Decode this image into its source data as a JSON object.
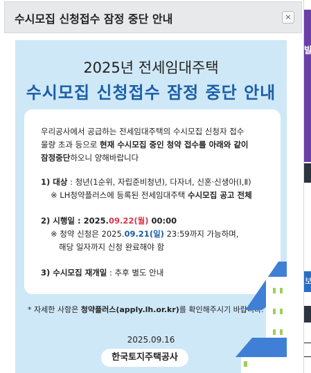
{
  "popup": {
    "title": "수시모집 신청접수 잠정 중단 안내",
    "close_label": "×"
  },
  "notice": {
    "title_line1": "2025년 전세임대주택",
    "title_line2": "수시모집 신청접수 잠정 중단 안내",
    "intro": {
      "line1": "우리공사에서 공급하는 전세임대주택의 수시모집 신청자 접수",
      "line2_a": "물량 초과 등으로 ",
      "line2_b": "현재 수시모집 중인 청약 접수를 아래와 같이",
      "line3_a": "잠정중단",
      "line3_b": "하오니 양해바랍니다"
    },
    "item1": {
      "label": "1) 대상",
      "text": " : 청년(1순위, 자립준비청년), 다자녀, 신혼·신생아(Ⅰ,Ⅱ)",
      "sub_a": "※ LH청약플러스에 등록된 전세임대주택 ",
      "sub_b": "수시모집 공고 전체"
    },
    "item2": {
      "label": "2) 시행일",
      "date_prefix": " : 2025.",
      "date_hl": "09.22",
      "day_hl": "(월)",
      "time": " 00:00",
      "sub1_a": "※ 청약 신청은 2025.",
      "sub1_date": "09.21",
      "sub1_day": "(일)",
      "sub1_b": " 23:59까지 가능하며,",
      "sub2": "해당 일자까지 신청 완료해야 함"
    },
    "item3": {
      "label": "3) 수시모집 재개일",
      "text": " : 추후 별도 안내"
    },
    "footnote_a": "* 자세한 사항은 ",
    "footnote_b": "청약플러스(apply.lh.or.kr)",
    "footnote_c": "를 확인해주시기 바랍니다.",
    "date": "2025.09.16",
    "organization": "한국토지주택공사"
  },
  "background": {
    "purple_snippet": "발",
    "blue_snippet": "l보"
  },
  "colors": {
    "title_blue": "#1a5ea8",
    "highlight_red": "#d8354b",
    "notice_bg": "#cfe8f7"
  }
}
